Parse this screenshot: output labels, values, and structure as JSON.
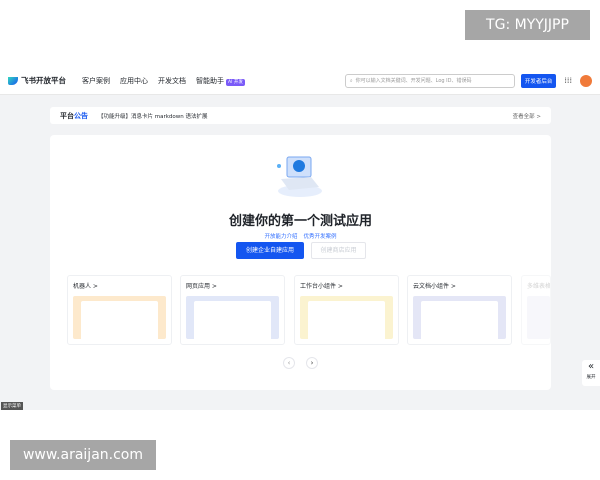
{
  "watermarks": {
    "top": "TG: MYYJJPP",
    "bottom": "www.araijan.com"
  },
  "nav": {
    "logo": "飞书开放平台",
    "items": [
      "客户案例",
      "应用中心",
      "开发文档",
      "智能助手"
    ],
    "badge": "AI 开发",
    "search_placeholder": "你可以输入文档关键词、开发问题、Log ID、错误码",
    "console": "开发者后台"
  },
  "notice": {
    "label_a": "平台",
    "label_b": "公告",
    "text": "【功能升级】消息卡片 markdown 语法扩展",
    "view_all": "查看全部 >"
  },
  "main": {
    "title": "创建你的第一个测试应用",
    "links": [
      "开放能力介绍",
      "优秀开发案例"
    ],
    "primary": "创建企业自建应用",
    "secondary": "创建商店应用",
    "cards": [
      {
        "label": "机器人 >",
        "color": "#fde9cc"
      },
      {
        "label": "网页应用 >",
        "color": "#e1e7f8"
      },
      {
        "label": "工作台小组件 >",
        "color": "#fbf3d0"
      },
      {
        "label": "云文档小组件 >",
        "color": "#e4e6f6"
      },
      {
        "label": "多维表格",
        "color": "#f0f1f8"
      }
    ]
  },
  "pager": {
    "prev": "‹",
    "next": "›"
  },
  "side": {
    "icon": "«",
    "label": "展开"
  },
  "menu": "显示菜单"
}
